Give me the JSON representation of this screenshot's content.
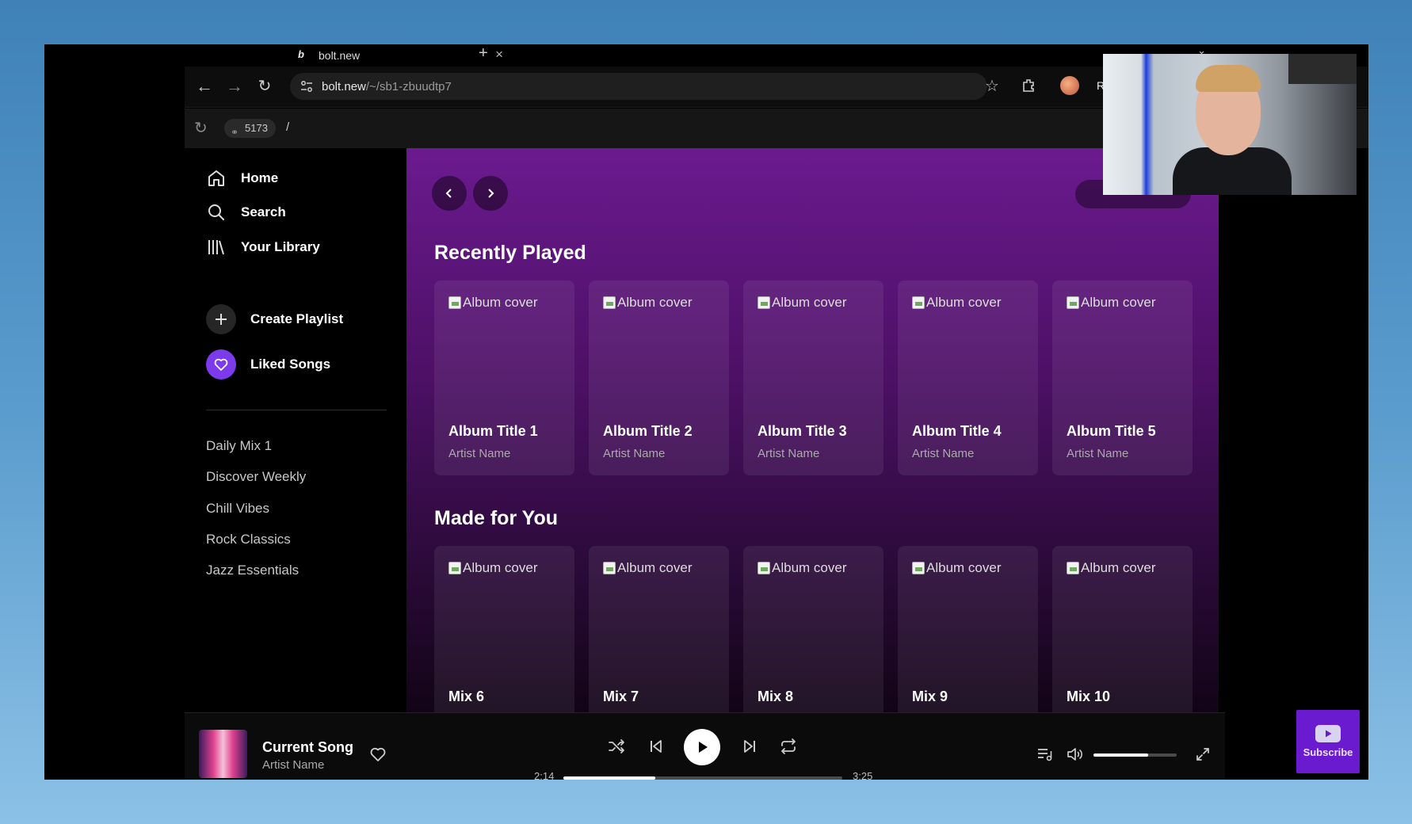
{
  "browser": {
    "tab_title": "bolt.new",
    "tab_favicon": "b",
    "tab_close": "×",
    "new_tab": "+",
    "url_host": "bolt.new",
    "url_path": "/~/sb1-zbuudtp7",
    "relaunch_label": "Re"
  },
  "devbar": {
    "port": "5173",
    "path": "/"
  },
  "sidebar": {
    "nav": [
      {
        "label": "Home",
        "icon": "home-icon"
      },
      {
        "label": "Search",
        "icon": "search-icon"
      },
      {
        "label": "Your Library",
        "icon": "library-icon"
      }
    ],
    "actions": {
      "create_playlist": "Create Playlist",
      "liked_songs": "Liked Songs"
    },
    "playlists": [
      "Daily Mix 1",
      "Discover Weekly",
      "Chill Vibes",
      "Rock Classics",
      "Jazz Essentials"
    ]
  },
  "main": {
    "recently_played": {
      "title": "Recently Played",
      "cards": [
        {
          "cover_alt": "Album cover",
          "title": "Album Title 1",
          "artist": "Artist Name"
        },
        {
          "cover_alt": "Album cover",
          "title": "Album Title 2",
          "artist": "Artist Name"
        },
        {
          "cover_alt": "Album cover",
          "title": "Album Title 3",
          "artist": "Artist Name"
        },
        {
          "cover_alt": "Album cover",
          "title": "Album Title 4",
          "artist": "Artist Name"
        },
        {
          "cover_alt": "Album cover",
          "title": "Album Title 5",
          "artist": "Artist Name"
        }
      ]
    },
    "made_for_you": {
      "title": "Made for You",
      "cards": [
        {
          "cover_alt": "Album cover",
          "title": "Mix 6"
        },
        {
          "cover_alt": "Album cover",
          "title": "Mix 7"
        },
        {
          "cover_alt": "Album cover",
          "title": "Mix 8"
        },
        {
          "cover_alt": "Album cover",
          "title": "Mix 9"
        },
        {
          "cover_alt": "Album cover",
          "title": "Mix 10"
        }
      ]
    }
  },
  "player": {
    "song_title": "Current Song",
    "artist": "Artist Name",
    "elapsed": "2:14",
    "duration": "3:25",
    "progress_fraction": 0.33,
    "volume_fraction": 0.66
  },
  "overlay": {
    "subscribe_label": "Subscribe"
  },
  "colors": {
    "accent_purple": "#6b1a8f",
    "liked_songs": "#7c3aed",
    "subscribe_bg": "#6a1bd0"
  }
}
